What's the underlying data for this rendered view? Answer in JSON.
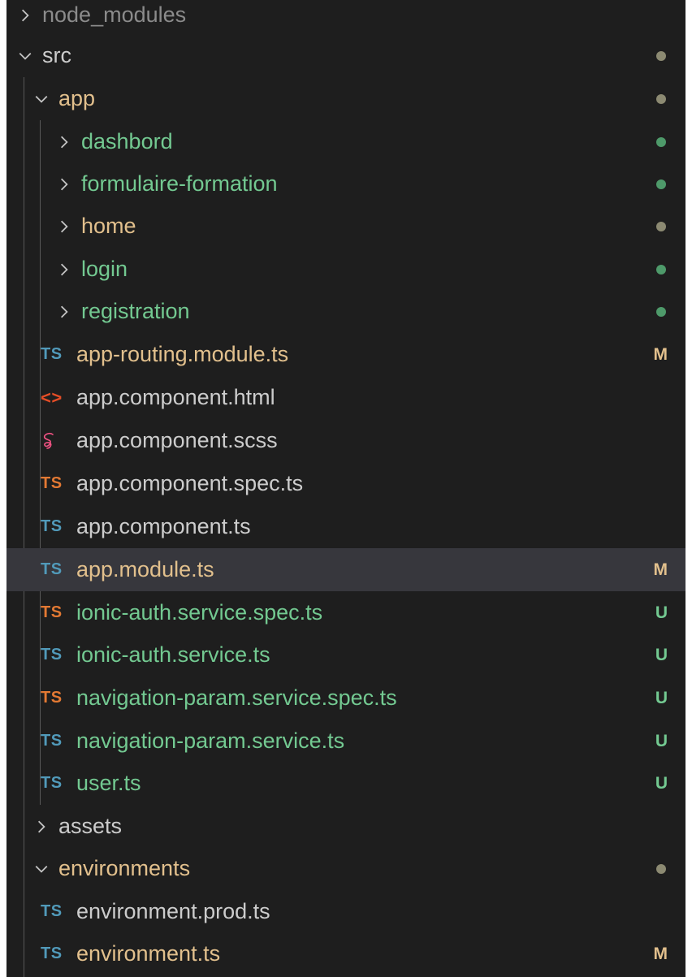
{
  "colors": {
    "background": "#1e1e1e",
    "selected_background": "#37373d",
    "label_default": "#cccccc",
    "modified": "#e2c08d",
    "untracked": "#73c991",
    "ts_blue": "#519aba",
    "ts_orange": "#e37933",
    "html_orange": "#e44d26",
    "scss_pink": "#f55385",
    "dot_gray": "#8c8a72"
  },
  "tree": {
    "rows": [
      {
        "label": "node_modules",
        "kind": "folder",
        "expanded": false,
        "icon": "chevron-right-icon",
        "status": "",
        "color": "#8b8b8b"
      },
      {
        "label": "src",
        "kind": "folder",
        "expanded": true,
        "icon": "chevron-down-icon",
        "status": "dot",
        "color": "#cccccc"
      },
      {
        "label": "app",
        "kind": "folder",
        "expanded": true,
        "icon": "chevron-down-icon",
        "status": "dot",
        "color": "#e2c08d"
      },
      {
        "label": "dashbord",
        "kind": "folder",
        "expanded": false,
        "icon": "chevron-right-icon",
        "status": "dot",
        "color": "#73c991"
      },
      {
        "label": "formulaire-formation",
        "kind": "folder",
        "expanded": false,
        "icon": "chevron-right-icon",
        "status": "dot",
        "color": "#73c991"
      },
      {
        "label": "home",
        "kind": "folder",
        "expanded": false,
        "icon": "chevron-right-icon",
        "status": "dot",
        "color": "#e2c08d"
      },
      {
        "label": "login",
        "kind": "folder",
        "expanded": false,
        "icon": "chevron-right-icon",
        "status": "dot",
        "color": "#73c991"
      },
      {
        "label": "registration",
        "kind": "folder",
        "expanded": false,
        "icon": "chevron-right-icon",
        "status": "dot",
        "color": "#73c991"
      },
      {
        "label": "app-routing.module.ts",
        "kind": "file",
        "icon": "typescript-icon",
        "icon_text": "TS",
        "status": "M",
        "color": "#e2c08d"
      },
      {
        "label": "app.component.html",
        "kind": "file",
        "icon": "html-icon",
        "icon_text": "<>",
        "status": "",
        "color": "#cccccc"
      },
      {
        "label": "app.component.scss",
        "kind": "file",
        "icon": "sass-icon",
        "icon_text": "",
        "status": "",
        "color": "#cccccc"
      },
      {
        "label": "app.component.spec.ts",
        "kind": "file",
        "icon": "typescript-spec-icon",
        "icon_text": "TS",
        "status": "",
        "color": "#cccccc"
      },
      {
        "label": "app.component.ts",
        "kind": "file",
        "icon": "typescript-icon",
        "icon_text": "TS",
        "status": "",
        "color": "#cccccc"
      },
      {
        "label": "app.module.ts",
        "kind": "file",
        "icon": "typescript-icon",
        "icon_text": "TS",
        "status": "M",
        "color": "#e2c08d",
        "selected": true
      },
      {
        "label": "ionic-auth.service.spec.ts",
        "kind": "file",
        "icon": "typescript-spec-icon",
        "icon_text": "TS",
        "status": "U",
        "color": "#73c991"
      },
      {
        "label": "ionic-auth.service.ts",
        "kind": "file",
        "icon": "typescript-icon",
        "icon_text": "TS",
        "status": "U",
        "color": "#73c991"
      },
      {
        "label": "navigation-param.service.spec.ts",
        "kind": "file",
        "icon": "typescript-spec-icon",
        "icon_text": "TS",
        "status": "U",
        "color": "#73c991"
      },
      {
        "label": "navigation-param.service.ts",
        "kind": "file",
        "icon": "typescript-icon",
        "icon_text": "TS",
        "status": "U",
        "color": "#73c991"
      },
      {
        "label": "user.ts",
        "kind": "file",
        "icon": "typescript-icon",
        "icon_text": "TS",
        "status": "U",
        "color": "#73c991"
      },
      {
        "label": "assets",
        "kind": "folder",
        "expanded": false,
        "icon": "chevron-right-icon",
        "status": "",
        "color": "#cccccc"
      },
      {
        "label": "environments",
        "kind": "folder",
        "expanded": true,
        "icon": "chevron-down-icon",
        "status": "dot",
        "color": "#e2c08d"
      },
      {
        "label": "environment.prod.ts",
        "kind": "file",
        "icon": "typescript-icon",
        "icon_text": "TS",
        "status": "",
        "color": "#cccccc"
      },
      {
        "label": "environment.ts",
        "kind": "file",
        "icon": "typescript-icon",
        "icon_text": "TS",
        "status": "M",
        "color": "#e2c08d"
      }
    ]
  }
}
